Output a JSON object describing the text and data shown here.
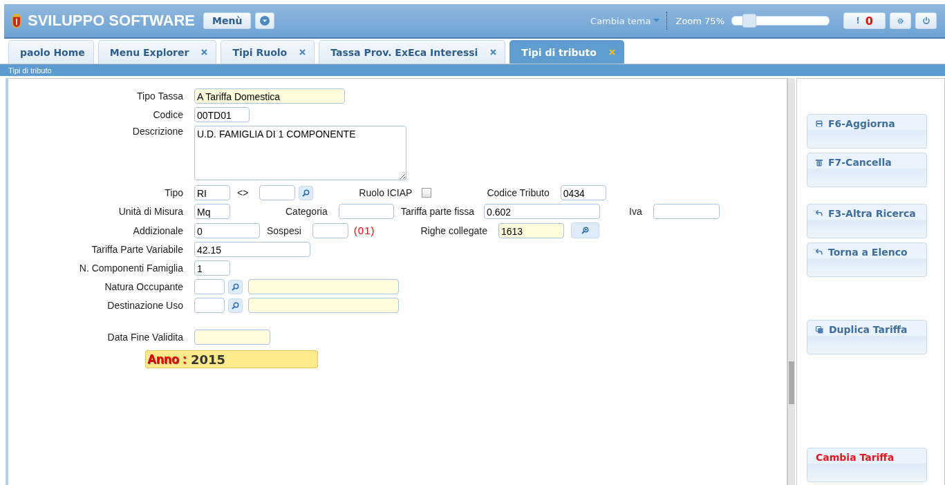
{
  "header": {
    "title": "SVILUPPO SOFTWARE",
    "menu_button": "Menù",
    "theme_label": "Cambia tema",
    "zoom": {
      "label": "Zoom 75%",
      "level": 0.12
    },
    "alert_mark": "!",
    "alert_count": "0"
  },
  "tabs": [
    {
      "label": "paolo Home",
      "closable": false,
      "selected": false
    },
    {
      "label": "Menu Explorer",
      "closable": true,
      "selected": false
    },
    {
      "label": "Tipi Ruolo",
      "closable": true,
      "selected": false
    },
    {
      "label": "Tassa Prov. ExEca Interessi",
      "closable": true,
      "selected": false
    },
    {
      "label": "Tipi di tributo",
      "closable": true,
      "selected": true
    }
  ],
  "breadcrumb": "Tipi di tributo",
  "form": {
    "tipo_tassa": {
      "label": "Tipo Tassa",
      "value": "A Tariffa Domestica",
      "readonly": true
    },
    "codice": {
      "label": "Codice",
      "value": "00TD01",
      "readonly": false
    },
    "descrizione": {
      "label": "Descrizione",
      "value": "U.D. FAMIGLIA DI 1 COMPONENTE",
      "readonly": false
    },
    "tipo": {
      "label": "Tipo",
      "value": "RI",
      "readonly": false
    },
    "tipo_operator": "<>",
    "tipo_other": {
      "readonly": false
    },
    "ruolo_iciap": {
      "label": "Ruolo ICIAP",
      "checked": false
    },
    "codice_tributo": {
      "label": "Codice Tributo",
      "value": "0434",
      "readonly": false
    },
    "unita_misura": {
      "label": "Unità di Misura",
      "value": "Mq",
      "readonly": false
    },
    "categoria": {
      "label": "Categoria",
      "readonly": false
    },
    "tariffa_fissa": {
      "label": "Tariffa parte fissa",
      "value": "0.602",
      "readonly": false
    },
    "iva": {
      "label": "Iva",
      "readonly": false
    },
    "addizionale": {
      "label": "Addizionale",
      "value": "0",
      "readonly": false
    },
    "sospesi": {
      "label": "Sospesi",
      "readonly": false,
      "note": "(01)"
    },
    "righe_collegate": {
      "label": "Righe collegate",
      "value": "1613",
      "readonly": true
    },
    "tariffa_variabile": {
      "label": "Tariffa Parte Variabile",
      "value": "42.15",
      "readonly": false
    },
    "n_componenti": {
      "label": "N. Componenti Famiglia",
      "value": "1",
      "readonly": false
    },
    "natura_occupante": {
      "label": "Natura Occupante",
      "code": {
        "readonly": false
      },
      "description": {
        "readonly": true
      }
    },
    "destinazione_uso": {
      "label": "Destinazione Uso",
      "code": {
        "readonly": false
      },
      "description": {
        "readonly": true
      }
    },
    "data_fine": {
      "label": "Data Fine Validita",
      "readonly": true
    },
    "anno": {
      "label": "Anno :",
      "value": "2015"
    }
  },
  "action_groups": [
    [
      {
        "label": "F6-Aggiorna",
        "kind": "save",
        "danger": false
      },
      {
        "label": "F7-Cancella",
        "kind": "delete",
        "danger": false
      }
    ],
    [
      {
        "label": "F3-Altra Ricerca",
        "kind": "back",
        "danger": false
      },
      {
        "label": "Torna a Elenco",
        "kind": "back",
        "danger": false
      }
    ],
    [
      {
        "label": "Duplica Tariffa",
        "kind": "copy",
        "danger": false
      }
    ],
    [
      {
        "label": "Cambia Tariffa",
        "kind": "plain",
        "danger": true
      }
    ]
  ]
}
